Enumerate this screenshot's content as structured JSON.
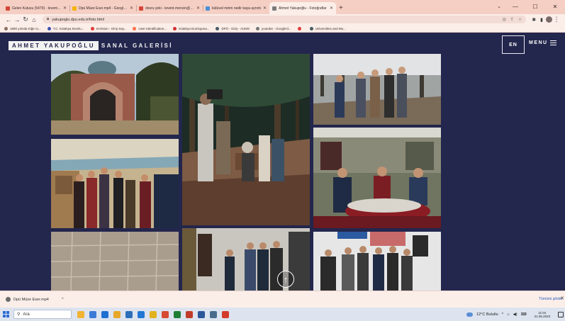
{
  "browser": {
    "tabs": [
      {
        "title": "Gelen Kutusu (5479) - leventmen",
        "favicon_color": "#d44638",
        "active": false
      },
      {
        "title": "Dpü Müze Eser.mp4 - Google Dr",
        "favicon_color": "#f4b400",
        "active": false
      },
      {
        "title": "dosru yeki - levent.mencin@dpu",
        "favicon_color": "#d44638",
        "active": false
      },
      {
        "title": "kütüvel mirim nedir kaya ayrıntı",
        "favicon_color": "#4a90d9",
        "active": false
      },
      {
        "title": "Ahmet Yakupoğlu - Fotoğraflar",
        "favicon_color": "#7a7a7a",
        "active": true
      }
    ],
    "new_tab": "+",
    "window_controls": {
      "minimize": "—",
      "maximize": "☐",
      "close": "✕"
    },
    "url": "yakupoglu.dpu.edu.tr/foto.html",
    "bookmarks": [
      {
        "label": "1890 yılında Kiğe ru...",
        "color": "#8d6e63"
      },
      {
        "label": "T.C. Kütahya Dumlu...",
        "color": "#3f51b5"
      },
      {
        "label": "enVision - Giriş Say...",
        "color": "#e53935"
      },
      {
        "label": "User Identification...",
        "color": "#ff7043"
      },
      {
        "label": "Kütahya Dumlupına...",
        "color": "#d32f2f"
      },
      {
        "label": "DPÜ - Giriş - AUMS",
        "color": "#455a64"
      },
      {
        "label": "youtube - Google'd...",
        "color": "#757575"
      },
      {
        "label": "",
        "color": "#e53935"
      },
      {
        "label": "Universities and Mu...",
        "color": "#455a64"
      }
    ]
  },
  "site": {
    "brand_name": "AHMET YAKUPOĞLU",
    "brand_sub": "SANAL GALERİSİ",
    "lang_button": "EN",
    "menu_label": "MENU",
    "scroll_top_icon": "↑"
  },
  "gallery": {
    "photos": [
      {
        "name": "photo-stone-gate-dome",
        "subject": "stone arched gate with domed tomb"
      },
      {
        "name": "photo-forest-camera-crew",
        "subject": "film crew recording in pine forest"
      },
      {
        "name": "photo-forest-group",
        "subject": "group of men standing in forest"
      },
      {
        "name": "photo-exhibition-hall",
        "subject": "visitors viewing paintings in exhibition hall"
      },
      {
        "name": "photo-banquet-table",
        "subject": "men seated at banquet table with red tablecloth"
      },
      {
        "name": "photo-tiled-wall",
        "subject": "close-up of tiled wall"
      },
      {
        "name": "photo-gallery-visitors",
        "subject": "men in suits visiting a gallery"
      },
      {
        "name": "photo-group-stage",
        "subject": "group of men in suits in front of banner"
      }
    ]
  },
  "download_bar": {
    "filename": "Dpü Müze Eser.mp4",
    "chevron": "^",
    "show_all": "Tümünü göster",
    "close": "✕"
  },
  "taskbar": {
    "search_placeholder": "Ara",
    "weather": "12°C Bulutlu",
    "time": "11:04",
    "date": "21.05.2023",
    "app_colors": [
      "#f2b233",
      "#3b7ad6",
      "#1f6fd1",
      "#e8a82a",
      "#2c6fb8",
      "#2277d4",
      "#e2b21e",
      "#d64a32",
      "#1e7e34",
      "#c13b2b",
      "#2b579a",
      "#4a6c8c",
      "#d33b2b"
    ]
  }
}
